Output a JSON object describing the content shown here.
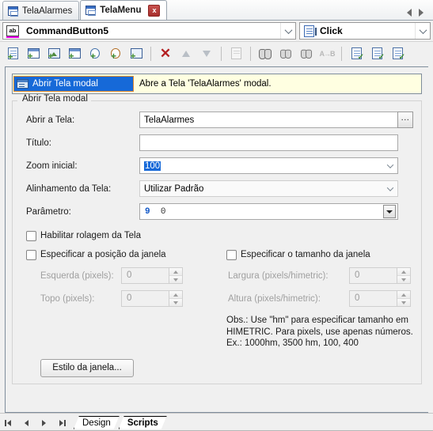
{
  "window": {
    "document_tabs": [
      {
        "label": "TelaAlarmes",
        "active": false,
        "closable": false
      },
      {
        "label": "TelaMenu",
        "active": true,
        "closable": true,
        "close_label": "x"
      }
    ],
    "nav_prev": "◁",
    "nav_next": "▷"
  },
  "selector": {
    "object": {
      "value": "CommandButton5",
      "icon": "ab-textbox-icon"
    },
    "event": {
      "value": "Click",
      "icon": "event-script-icon"
    }
  },
  "toolbar": {
    "buttons": [
      {
        "name": "new-script-item",
        "icon": "document-add-icon"
      },
      {
        "name": "new-window-item",
        "icon": "window-add-icon"
      },
      {
        "name": "new-picture-item",
        "icon": "picture-add-icon"
      },
      {
        "name": "new-dialog-item",
        "icon": "dialog-add-icon"
      },
      {
        "name": "add-download-item",
        "icon": "download-add-icon"
      },
      {
        "name": "add-loop-item",
        "icon": "loop-add-icon"
      },
      {
        "name": "add-report-item",
        "icon": "report-add-icon"
      },
      {
        "name": "delete-item",
        "icon": "red-x-icon"
      },
      {
        "name": "move-up",
        "icon": "arrow-up-icon"
      },
      {
        "name": "move-down",
        "icon": "arrow-down-icon"
      },
      {
        "name": "cut-item",
        "icon": "cut-icon"
      },
      {
        "name": "find",
        "icon": "binoculars-icon"
      },
      {
        "name": "find-previous",
        "icon": "binoculars-prev-icon"
      },
      {
        "name": "find-next",
        "icon": "binoculars-next-icon"
      },
      {
        "name": "replace",
        "icon": "replace-ab-icon"
      },
      {
        "name": "validate-script",
        "icon": "document-check-icon"
      },
      {
        "name": "validate-all",
        "icon": "document-check-all-icon"
      },
      {
        "name": "compile",
        "icon": "document-compile-icon"
      }
    ]
  },
  "action": {
    "selected_label": "Abrir Tela modal",
    "description": "Abre a Tela 'TelaAlarmes' modal.",
    "icon": "open-screen-icon"
  },
  "group": {
    "title": "Abrir Tela modal",
    "fields": {
      "screen": {
        "label": "Abrir a Tela:",
        "value": "TelaAlarmes",
        "browse_label": "..."
      },
      "title": {
        "label": "Título:",
        "value": ""
      },
      "zoom": {
        "label": "Zoom inicial:",
        "value": "100"
      },
      "alignment": {
        "label": "Alinhamento da Tela:",
        "value": "Utilizar Padrão"
      },
      "parameter": {
        "label": "Parâmetro:",
        "value_key": "9",
        "value_num": "0"
      }
    },
    "checkboxes": {
      "scroll": {
        "label": "Habilitar rolagem da Tela",
        "checked": false
      },
      "position": {
        "label": "Especificar a posição da janela",
        "checked": false
      },
      "size": {
        "label": "Especificar o tamanho da janela",
        "checked": false
      }
    },
    "position_fields": [
      {
        "label": "Esquerda (pixels):",
        "value": "0"
      },
      {
        "label": "Topo (pixels):",
        "value": "0"
      }
    ],
    "size_fields": [
      {
        "label": "Largura (pixels/himetric):",
        "value": "0"
      },
      {
        "label": "Altura (pixels/himetric):",
        "value": "0"
      }
    ],
    "note_lines": [
      "Obs.: Use \"hm\" para especificar tamanho em",
      "HIMETRIC. Para pixels, use apenas números.",
      "Ex.: 1000hm, 3500 hm, 100, 400"
    ],
    "style_button": "Estilo da janela..."
  },
  "bottom": {
    "nav": [
      "first",
      "prev",
      "next",
      "last"
    ],
    "sheets": [
      {
        "label": "Design",
        "active": false
      },
      {
        "label": "Scripts",
        "active": true
      }
    ]
  },
  "colors": {
    "accent_selection": "#1669d8",
    "selection_border": "#e08a2e",
    "action_bg": "#ffffe1",
    "close_red": "#a62f2c",
    "param_key_blue": "#1258c8",
    "magenta_underline": "#ff00ff"
  }
}
